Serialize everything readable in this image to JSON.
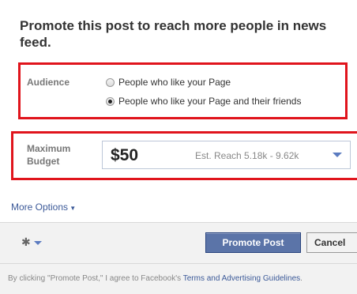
{
  "dialog": {
    "title": "Promote this post to reach more people in news feed."
  },
  "audience": {
    "label": "Audience",
    "options": [
      {
        "label": "People who like your Page",
        "selected": false
      },
      {
        "label": "People who like your Page and their friends",
        "selected": true
      }
    ]
  },
  "budget": {
    "label": "Maximum Budget",
    "value": "$50",
    "estimate": "Est. Reach 5.18k - 9.62k",
    "dropdown_icon": "chevron-down-icon"
  },
  "more_options": {
    "label": "More Options",
    "icon": "caret-down-icon"
  },
  "footer": {
    "settings_icon": "gear-icon",
    "promote_label": "Promote Post",
    "cancel_label": "Cancel",
    "terms_prefix": "By clicking \"Promote Post,\" I agree to Facebook's ",
    "terms_link": "Terms and Advertising Guidelines",
    "terms_suffix": "."
  },
  "colors": {
    "highlight_border": "#e0141c",
    "link": "#3b5998",
    "primary_button": "#5b74a8"
  }
}
